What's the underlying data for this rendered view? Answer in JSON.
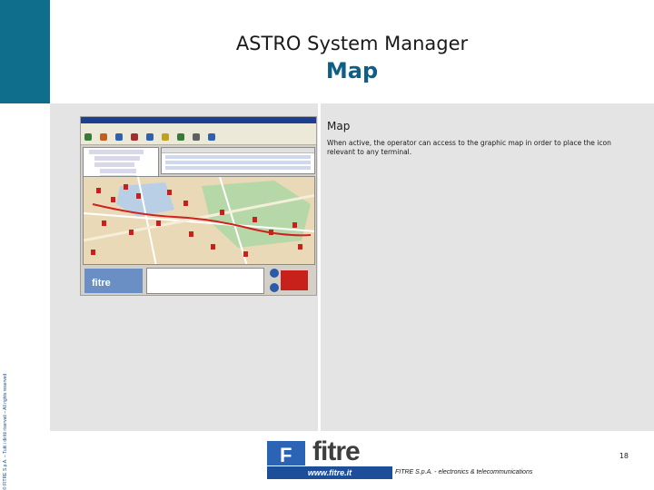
{
  "slide": {
    "title": "ASTRO System Manager",
    "subtitle": "Map",
    "copyright": "© FITRE S.p.A. – Tutti i diritti riservati – All rights reserved"
  },
  "content": {
    "section_title": "Map",
    "description": "When active, the operator can access to the graphic map in order to place the icon relevant to any terminal."
  },
  "screenshot": {
    "logo_text": "fitre"
  },
  "footer": {
    "logo_text": "fitre",
    "url": "www.fitre.it",
    "company": "FITRE S.p.A. - electronics & telecommunications",
    "page_number": "18"
  },
  "colors": {
    "accent": "#0e6e8c",
    "subtitle": "#0e5e86",
    "content_bg": "#e4e4e4",
    "brand_blue": "#1c4e99"
  },
  "icons": {
    "logo": "fitre-cloud-logo-icon"
  }
}
